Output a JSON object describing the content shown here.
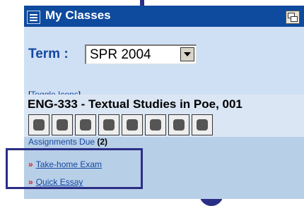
{
  "portlet": {
    "title": "My Classes",
    "term_label": "Term :",
    "term_value": "SPR 2004",
    "toggle_prefix": "[",
    "toggle_label": "Toggle Icons",
    "toggle_suffix": "]"
  },
  "course": {
    "title": "ENG-333 - Textual Studies in Poe, 001",
    "tools": [
      "announcements-icon",
      "users-icon",
      "tools-icon",
      "folder-icon",
      "chat-icon",
      "book-icon",
      "assignment-icon",
      "gradebook-icon"
    ]
  },
  "assignments": {
    "label": "Assignments Due",
    "count": "(2)",
    "items": [
      {
        "label": "Take-home Exam"
      },
      {
        "label": "Quick Essay"
      }
    ]
  },
  "colors": {
    "header_bg": "#0e4a9e",
    "body_bg": "#cfe0f4",
    "highlight": "#2a2f86",
    "bullet": "#e02020"
  }
}
